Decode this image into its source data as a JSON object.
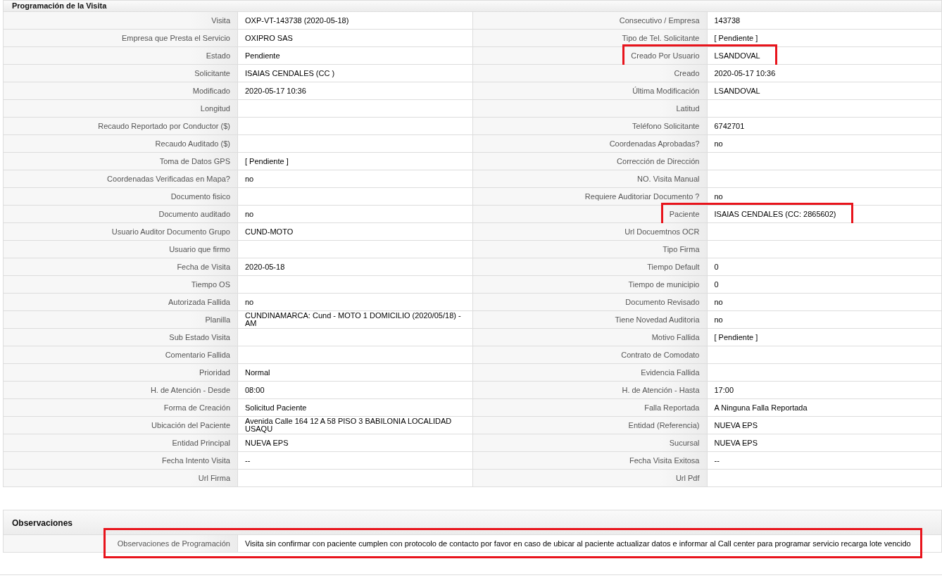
{
  "sections": [
    {
      "title": "Programación de la Visita",
      "kind": "pairs",
      "rows": [
        {
          "left": {
            "label": "Visita",
            "value": "OXP-VT-143738 (2020-05-18)",
            "highlighted": false
          },
          "right": {
            "label": "Consecutivo / Empresa",
            "value": "143738",
            "highlighted": false
          }
        },
        {
          "left": {
            "label": "Empresa que Presta el Servicio",
            "value": "OXIPRO SAS",
            "highlighted": false
          },
          "right": {
            "label": "Tipo de Tel. Solicitante",
            "value": "[ Pendiente ]",
            "highlighted": false
          }
        },
        {
          "left": {
            "label": "Estado",
            "value": "Pendiente",
            "highlighted": false
          },
          "right": {
            "label": "Creado Por Usuario",
            "value": "LSANDOVAL",
            "highlighted": true
          }
        },
        {
          "left": {
            "label": "Solicitante",
            "value": "ISAIAS CENDALES (CC )",
            "highlighted": false
          },
          "right": {
            "label": "Creado",
            "value": "2020-05-17 10:36",
            "highlighted": false
          }
        },
        {
          "left": {
            "label": "Modificado",
            "value": "2020-05-17 10:36",
            "highlighted": false
          },
          "right": {
            "label": "Última Modificación",
            "value": "LSANDOVAL",
            "highlighted": false
          }
        },
        {
          "left": {
            "label": "Longitud",
            "highlighted": false
          },
          "right": {
            "label": "Latitud",
            "highlighted": false
          }
        },
        {
          "left": {
            "label": "Recaudo Reportado por Conductor ($)",
            "highlighted": false
          },
          "right": {
            "label": "Teléfono Solicitante",
            "value": "6742701",
            "highlighted": false
          }
        },
        {
          "left": {
            "label": "Recaudo Auditado ($)",
            "highlighted": false
          },
          "right": {
            "label": "Coordenadas Aprobadas?",
            "value": "no",
            "highlighted": false
          }
        },
        {
          "left": {
            "label": "Toma de Datos GPS",
            "value": "[ Pendiente ]",
            "highlighted": false
          },
          "right": {
            "label": "Corrección de Dirección",
            "highlighted": false
          }
        },
        {
          "left": {
            "label": "Coordenadas Verificadas en Mapa?",
            "value": "no",
            "highlighted": false
          },
          "right": {
            "label": "NO. Visita Manual",
            "highlighted": false
          }
        },
        {
          "left": {
            "label": "Documento fisico",
            "highlighted": false
          },
          "right": {
            "label": "Requiere Auditoriar Documento ?",
            "value": "no",
            "highlighted": false
          }
        },
        {
          "left": {
            "label": "Documento auditado",
            "value": "no",
            "highlighted": false
          },
          "right": {
            "label": "Paciente",
            "value": "ISAIAS CENDALES (CC: 2865602)",
            "highlighted": true
          }
        },
        {
          "left": {
            "label": "Usuario Auditor Documento Grupo",
            "value": "CUND-MOTO",
            "highlighted": false
          },
          "right": {
            "label": "Url Docuemtnos OCR",
            "highlighted": false
          }
        },
        {
          "left": {
            "label": "Usuario que firmo",
            "highlighted": false
          },
          "right": {
            "label": "Tipo Firma",
            "highlighted": false
          }
        },
        {
          "left": {
            "label": "Fecha de Visita",
            "value": "2020-05-18",
            "highlighted": false
          },
          "right": {
            "label": "Tiempo Default",
            "value": "0",
            "highlighted": false
          }
        },
        {
          "left": {
            "label": "Tiempo OS",
            "highlighted": false
          },
          "right": {
            "label": "Tiempo de municipio",
            "value": "0",
            "highlighted": false
          }
        },
        {
          "left": {
            "label": "Autorizada Fallida",
            "value": "no",
            "highlighted": false
          },
          "right": {
            "label": "Documento Revisado",
            "value": "no",
            "highlighted": false
          }
        },
        {
          "left": {
            "label": "Planilla",
            "value": "CUNDINAMARCA: Cund - MOTO 1 DOMICILIO (2020/05/18) - AM",
            "highlighted": false
          },
          "right": {
            "label": "Tiene Novedad Auditoria",
            "value": "no",
            "highlighted": false
          }
        },
        {
          "left": {
            "label": "Sub Estado Visita",
            "highlighted": false
          },
          "right": {
            "label": "Motivo Fallida",
            "value": "[ Pendiente ]",
            "highlighted": false
          }
        },
        {
          "left": {
            "label": "Comentario Fallida",
            "highlighted": false
          },
          "right": {
            "label": "Contrato de Comodato",
            "highlighted": false
          }
        },
        {
          "left": {
            "label": "Prioridad",
            "value": "Normal",
            "highlighted": false
          },
          "right": {
            "label": "Evidencia Fallida",
            "highlighted": false
          }
        },
        {
          "left": {
            "label": "H. de Atención - Desde",
            "value": "08:00",
            "highlighted": false
          },
          "right": {
            "label": "H. de Atención - Hasta",
            "value": "17:00",
            "highlighted": false
          }
        },
        {
          "left": {
            "label": "Forma de Creación",
            "value": "Solicitud Paciente",
            "highlighted": false
          },
          "right": {
            "label": "Falla Reportada",
            "value": "A Ninguna Falla Reportada",
            "highlighted": false
          }
        },
        {
          "left": {
            "label": "Ubicación del Paciente",
            "value": "Avenida Calle 164 12 A 58 PISO 3 BABILONIA LOCALIDAD USAQU",
            "highlighted": false
          },
          "right": {
            "label": "Entidad (Referencia)",
            "value": "NUEVA EPS",
            "highlighted": false
          }
        },
        {
          "left": {
            "label": "Entidad Principal",
            "value": "NUEVA EPS",
            "highlighted": false
          },
          "right": {
            "label": "Sucursal",
            "value": "NUEVA EPS",
            "highlighted": false
          }
        },
        {
          "left": {
            "label": "Fecha Intento Visita",
            "value": "--",
            "highlighted": false
          },
          "right": {
            "label": "Fecha Visita Exitosa",
            "value": "--",
            "highlighted": false
          }
        },
        {
          "left": {
            "label": "Url Firma",
            "highlighted": false
          },
          "right": {
            "label": "Url Pdf",
            "highlighted": false
          }
        }
      ]
    },
    {
      "title": "Observaciones",
      "kind": "wide",
      "rows": [
        {
          "label": "Observaciones de Programación",
          "value": "Visita sin confirmar con paciente cumplen con protocolo de contacto por favor en caso de ubicar al paciente actualizar datos e informar al Call center para programar servicio recarga lote vencido",
          "highlighted": true
        }
      ]
    }
  ]
}
